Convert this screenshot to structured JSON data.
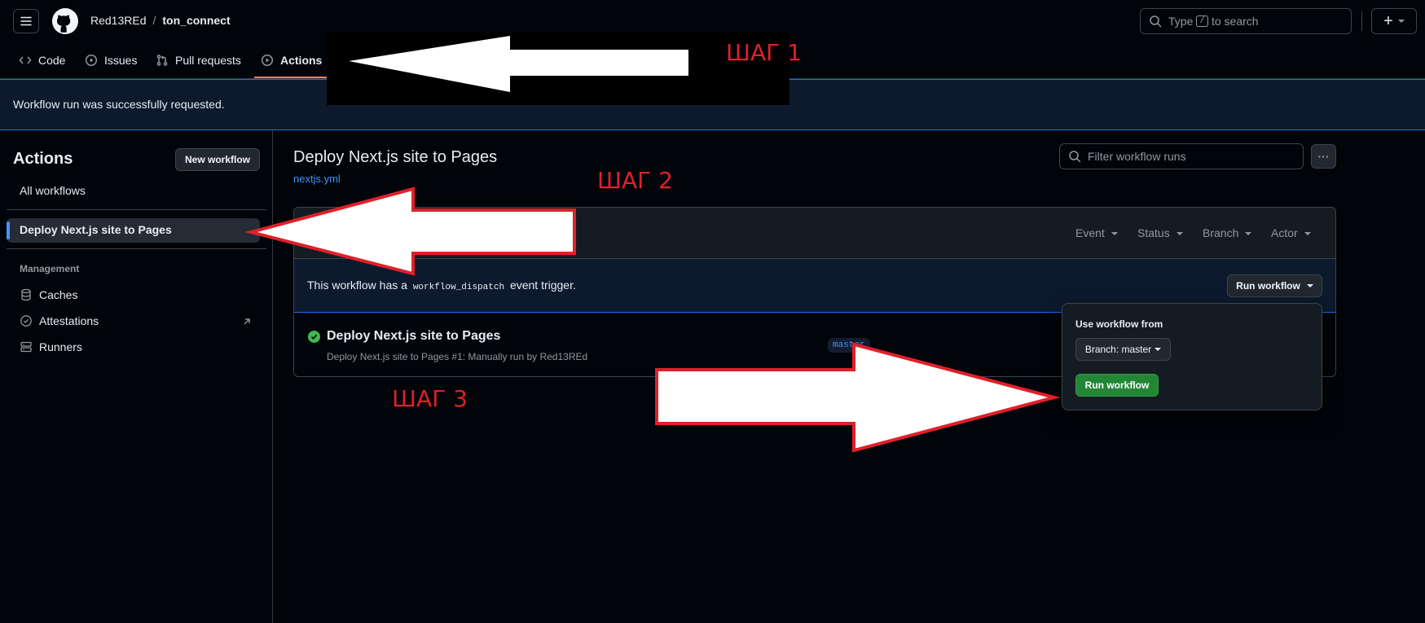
{
  "header": {
    "owner": "Red13REd",
    "separator": "/",
    "repo": "ton_connect",
    "search_placeholder_prefix": "Type",
    "search_key": "/",
    "search_placeholder_suffix": "to search",
    "plus": "+"
  },
  "tabs": [
    {
      "label": "Code",
      "icon": "code-icon"
    },
    {
      "label": "Issues",
      "icon": "issue-icon"
    },
    {
      "label": "Pull requests",
      "icon": "pull-request-icon"
    },
    {
      "label": "Actions",
      "icon": "play-icon",
      "selected": true
    }
  ],
  "flash": {
    "message": "Workflow run was successfully requested."
  },
  "sidebar": {
    "title": "Actions",
    "new_workflow": "New workflow",
    "all_workflows": "All workflows",
    "selected_workflow": "Deploy Next.js site to Pages",
    "management_heading": "Management",
    "management_items": [
      {
        "label": "Caches",
        "icon": "database-icon"
      },
      {
        "label": "Attestations",
        "icon": "verified-icon"
      },
      {
        "label": "Runners",
        "icon": "server-icon"
      }
    ]
  },
  "main": {
    "title": "Deploy Next.js site to Pages",
    "file_link": "nextjs.yml",
    "filter_placeholder": "Filter workflow runs",
    "more": "···",
    "filters": [
      "Event",
      "Status",
      "Branch",
      "Actor"
    ],
    "dispatch_prefix": "This workflow has a",
    "dispatch_code": "workflow_dispatch",
    "dispatch_suffix": "event trigger.",
    "run_workflow": "Run workflow",
    "run": {
      "title": "Deploy Next.js site to Pages",
      "subtitle": "Deploy Next.js site to Pages #1: Manually run by Red13REd",
      "branch": "master"
    }
  },
  "popover": {
    "heading": "Use workflow from",
    "branch_label": "Branch: master",
    "submit": "Run workflow"
  },
  "annotations": {
    "step1": "ШАГ 1",
    "step2": "ШАГ 2",
    "step3": "ШАГ 3"
  },
  "colors": {
    "accent": "#1f6feb",
    "link": "#4493f8",
    "success": "#238636",
    "annotation": "#e0202a"
  }
}
